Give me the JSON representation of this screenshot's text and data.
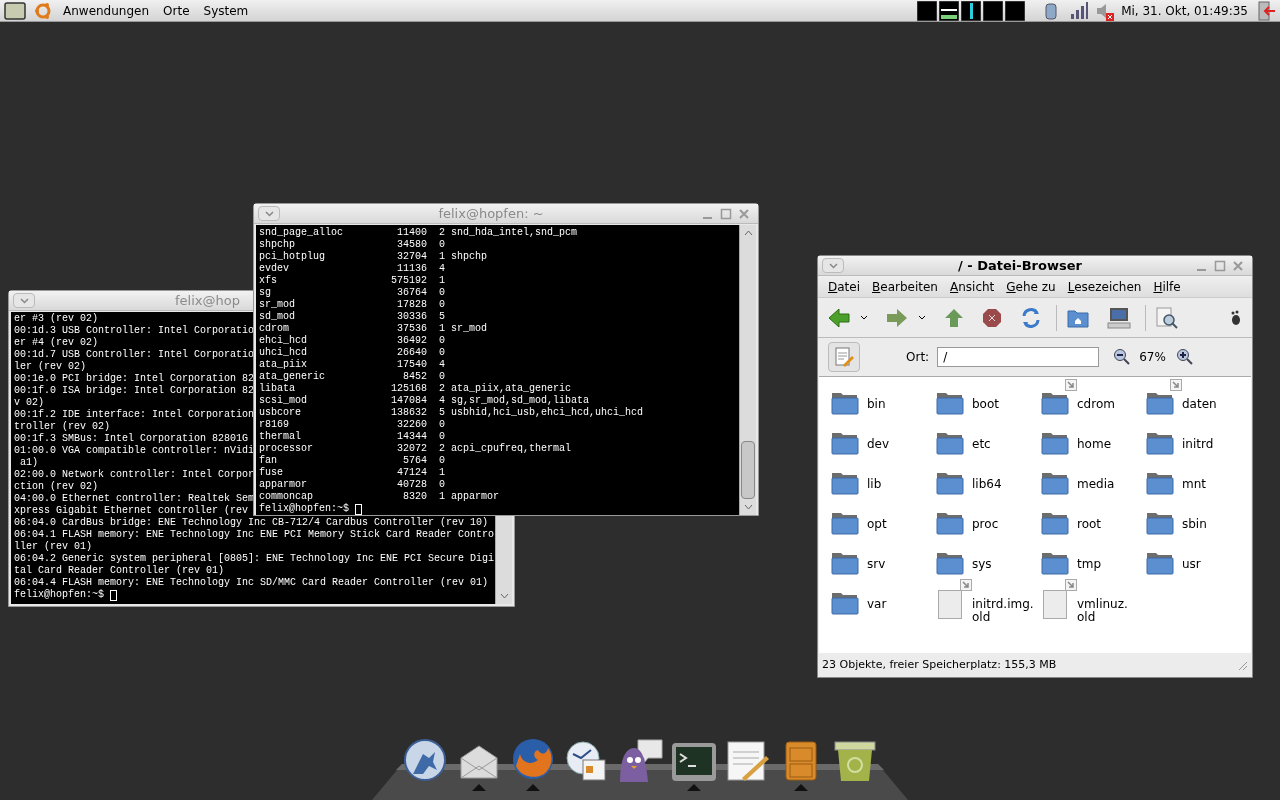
{
  "top_panel": {
    "menus": [
      "Anwendungen",
      "Orte",
      "System"
    ],
    "clock": "Mi, 31. Okt, 01:49:35"
  },
  "terminal_back": {
    "title": "felix@hop",
    "active": false,
    "lines": [
      "er #3 (rev 02)",
      "00:1d.3 USB Controller: Intel Corporatio",
      "er #4 (rev 02)",
      "00:1d.7 USB Controller: Intel Corporatio",
      "ler (rev 02)",
      "00:1e.0 PCI bridge: Intel Corporation 82",
      "00:1f.0 ISA bridge: Intel Corporation 82",
      "v 02)",
      "00:1f.2 IDE interface: Intel Corporation",
      "troller (rev 02)",
      "00:1f.3 SMBus: Intel Corporation 82801G",
      "01:00.0 VGA compatible controller: nVidi",
      " a1)",
      "02:00.0 Network controller: Intel Corpor",
      "ction (rev 02)",
      "04:00.0 Ethernet controller: Realtek Sem",
      "xpress Gigabit Ethernet controller (rev",
      "06:04.0 CardBus bridge: ENE Technology Inc CB-712/4 Cardbus Controller (rev 10)",
      "06:04.1 FLASH memory: ENE Technology Inc ENE PCI Memory Stick Card Reader Contro",
      "ller (rev 01)",
      "06:04.2 Generic system peripheral [0805]: ENE Technology Inc ENE PCI Secure Digi",
      "tal Card Reader Controller (rev 01)",
      "06:04.4 FLASH memory: ENE Technology Inc SD/MMC Card Reader Controller (rev 01)"
    ],
    "prompt": "felix@hopfen:~$"
  },
  "terminal_front": {
    "title": "felix@hopfen: ~",
    "active": false,
    "rows": [
      {
        "module": "snd_page_alloc",
        "size": "11400",
        "used": "2",
        "by": "snd_hda_intel,snd_pcm"
      },
      {
        "module": "shpchp",
        "size": "34580",
        "used": "0"
      },
      {
        "module": "pci_hotplug",
        "size": "32704",
        "used": "1",
        "by": "shpchp"
      },
      {
        "module": "evdev",
        "size": "11136",
        "used": "4"
      },
      {
        "module": "xfs",
        "size": "575192",
        "used": "1"
      },
      {
        "module": "sg",
        "size": "36764",
        "used": "0"
      },
      {
        "module": "sr_mod",
        "size": "17828",
        "used": "0"
      },
      {
        "module": "sd_mod",
        "size": "30336",
        "used": "5"
      },
      {
        "module": "cdrom",
        "size": "37536",
        "used": "1",
        "by": "sr_mod"
      },
      {
        "module": "ehci_hcd",
        "size": "36492",
        "used": "0"
      },
      {
        "module": "uhci_hcd",
        "size": "26640",
        "used": "0"
      },
      {
        "module": "ata_piix",
        "size": "17540",
        "used": "4"
      },
      {
        "module": "ata_generic",
        "size": "8452",
        "used": "0"
      },
      {
        "module": "libata",
        "size": "125168",
        "used": "2",
        "by": "ata_piix,ata_generic"
      },
      {
        "module": "scsi_mod",
        "size": "147084",
        "used": "4",
        "by": "sg,sr_mod,sd_mod,libata"
      },
      {
        "module": "usbcore",
        "size": "138632",
        "used": "5",
        "by": "usbhid,hci_usb,ehci_hcd,uhci_hcd"
      },
      {
        "module": "r8169",
        "size": "32260",
        "used": "0"
      },
      {
        "module": "thermal",
        "size": "14344",
        "used": "0"
      },
      {
        "module": "processor",
        "size": "32072",
        "used": "2",
        "by": "acpi_cpufreq,thermal"
      },
      {
        "module": "fan",
        "size": "5764",
        "used": "0"
      },
      {
        "module": "fuse",
        "size": "47124",
        "used": "1"
      },
      {
        "module": "apparmor",
        "size": "40728",
        "used": "0"
      },
      {
        "module": "commoncap",
        "size": "8320",
        "used": "1",
        "by": "apparmor"
      }
    ],
    "prompt": "felix@hopfen:~$"
  },
  "file_browser": {
    "title": "/ - Datei-Browser",
    "active": true,
    "menu": [
      "Datei",
      "Bearbeiten",
      "Ansicht",
      "Gehe zu",
      "Lesezeichen",
      "Hilfe"
    ],
    "location_label": "Ort:",
    "location": "/",
    "zoom": "67%",
    "items": [
      {
        "label_lines": [
          "bin"
        ],
        "kind": "folder",
        "link": false
      },
      {
        "label_lines": [
          "boot"
        ],
        "kind": "folder",
        "link": false
      },
      {
        "label_lines": [
          "cdrom"
        ],
        "kind": "folder",
        "link": true
      },
      {
        "label_lines": [
          "daten"
        ],
        "kind": "folder",
        "link": true
      },
      {
        "label_lines": [
          "dev"
        ],
        "kind": "folder",
        "link": false
      },
      {
        "label_lines": [
          "etc"
        ],
        "kind": "folder",
        "link": false
      },
      {
        "label_lines": [
          "home"
        ],
        "kind": "folder",
        "link": false
      },
      {
        "label_lines": [
          "initrd"
        ],
        "kind": "folder",
        "link": false
      },
      {
        "label_lines": [
          "lib"
        ],
        "kind": "folder",
        "link": false
      },
      {
        "label_lines": [
          "lib64"
        ],
        "kind": "folder",
        "link": false
      },
      {
        "label_lines": [
          "media"
        ],
        "kind": "folder",
        "link": false
      },
      {
        "label_lines": [
          "mnt"
        ],
        "kind": "folder",
        "link": false
      },
      {
        "label_lines": [
          "opt"
        ],
        "kind": "folder",
        "link": false
      },
      {
        "label_lines": [
          "proc"
        ],
        "kind": "folder",
        "link": false
      },
      {
        "label_lines": [
          "root"
        ],
        "kind": "folder",
        "link": false
      },
      {
        "label_lines": [
          "sbin"
        ],
        "kind": "folder",
        "link": false
      },
      {
        "label_lines": [
          "srv"
        ],
        "kind": "folder",
        "link": false
      },
      {
        "label_lines": [
          "sys"
        ],
        "kind": "folder",
        "link": false
      },
      {
        "label_lines": [
          "tmp"
        ],
        "kind": "folder",
        "link": false
      },
      {
        "label_lines": [
          "usr"
        ],
        "kind": "folder",
        "link": false
      },
      {
        "label_lines": [
          "var"
        ],
        "kind": "folder",
        "link": false
      },
      {
        "label_lines": [
          "initrd.img.",
          "old"
        ],
        "kind": "file",
        "link": true
      },
      {
        "label_lines": [
          "vmlinuz.",
          "old"
        ],
        "kind": "file",
        "link": true
      }
    ],
    "status_bar": "23 Objekte, freier Speicherplatz: 155,3 MB"
  },
  "dock": [
    {
      "kind": "wolf",
      "running": false
    },
    {
      "kind": "mail",
      "running": true
    },
    {
      "kind": "browser",
      "running": true
    },
    {
      "kind": "calendar",
      "running": false
    },
    {
      "kind": "chat",
      "running": false
    },
    {
      "kind": "terminal",
      "running": true
    },
    {
      "kind": "notes",
      "running": false
    },
    {
      "kind": "cabinet",
      "running": true
    },
    {
      "kind": "trash",
      "running": false
    }
  ]
}
